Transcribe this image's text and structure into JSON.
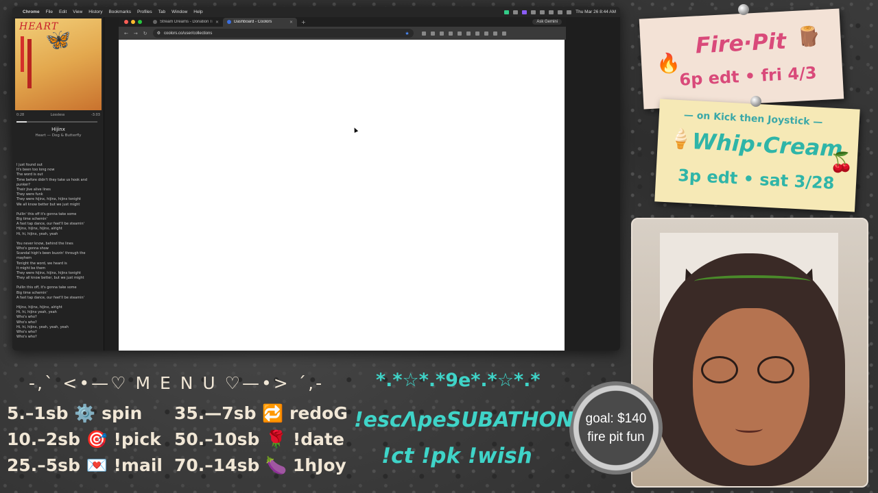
{
  "menubar": {
    "app": "Chrome",
    "items": [
      "File",
      "Edit",
      "View",
      "History",
      "Bookmarks",
      "Profiles",
      "Tab",
      "Window",
      "Help"
    ],
    "clock": "Thu Mar 26  8:44 AM"
  },
  "music": {
    "album_text": "HEART",
    "elapsed": "0:28",
    "quality": "Lossless",
    "remaining": "-3:03",
    "progress": 0.13,
    "title": "Hijinx",
    "artist": "Heart — Dog & Butterfly",
    "lyrics": [
      [
        "I just found out",
        "It's been too long now",
        "The word is out",
        "Time before didn't they take us hook and punker?",
        "Their jive alive lines",
        "They were funk",
        "They were hijinx, hijinx, hijinx tonight",
        "We all know better but we just might"
      ],
      [
        "Pullin' this off it's gonna take some",
        "Big time schemin'",
        "A fast tap dance, our feet'll be steamin'",
        "Hijinx, hijinx, hijinx, alright",
        "Hi, hi, hijinx, yeah, yeah"
      ],
      [
        "You never know, behind the lines",
        "Who's gonna show",
        "Scandal high's been buzzin' through the mayhem",
        "Tonight the word, we heard is",
        "It might be them",
        "They were hijinx, hijinx, hijinx tonight",
        "They all know better, but we just might"
      ],
      [
        "Pullin this off, it's gonna take some",
        "Big time schemin'",
        "A fast tap dance, our feet'll be steamin'"
      ],
      [
        "Hijinx, hijinx, hijinx, alright",
        "Hi, hi, hijinx yeah, yeah",
        "Who's who?",
        "Who's who?",
        "Hi, hi, hijinx, yeah, yeah, yeah",
        "Who's who?",
        "Who's who?"
      ]
    ]
  },
  "browser": {
    "tabs": [
      {
        "label": "Stream Dreams - Donation Tr...",
        "active": false
      },
      {
        "label": "Dashboard - Coolors",
        "active": true
      }
    ],
    "gemini": "Ask Gemini",
    "url": "coolors.co/user/collections"
  },
  "cards": {
    "firepit": {
      "emoji_left": "🔥",
      "title": "Fire·Pit",
      "emoji_right": "🪵",
      "sub": "6p edt • fri 4/3"
    },
    "whip": {
      "top": "— on Kick then Joystick —",
      "emoji_left": "🍦",
      "title": "Whip·Cream",
      "emoji_right": "🍒",
      "sub": "3p edt • sat 3/28"
    }
  },
  "goal": {
    "line1": "goal: $140",
    "line2": "fire pit fun"
  },
  "menu": {
    "heading": "-,` <•—♡ M E N U ♡—•> ´,-",
    "left": [
      "5.–1sb ⚙️ spin",
      "10.–2sb 🎯 !pick",
      "25.–5sb 💌 !mail"
    ],
    "right": [
      "35.—7sb 🔁 redoG",
      "50.–10sb 🌹 !date",
      "70.–14sb 🍆 1hJoy"
    ]
  },
  "subathon": {
    "deco": "*.*☆*.*9e*.*☆*.*",
    "title": "!escΛpeSUBATHON",
    "commands": "!ct !pk !wish"
  },
  "colors": {
    "menu_text": "#f1e7d6",
    "accent_teal": "#3fd4c8",
    "card_pink": "#d94a7a"
  }
}
